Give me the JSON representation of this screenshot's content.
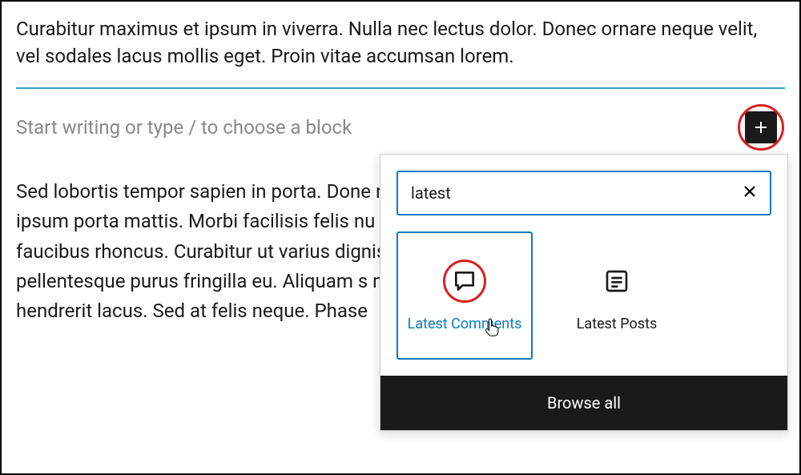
{
  "editor": {
    "paragraph_top": "Curabitur maximus et ipsum in viverra. Nulla nec lectus dolor. Donec ornare neque velit, vel sodales lacus mollis eget. Proin vitae accumsan lorem.",
    "placeholder": "Start writing or type / to choose a block",
    "paragraph_bottom": "Sed lobortis tempor sapien in porta. Done nibh facilisis. In id turpis malesuada, ultric ipsum porta mattis. Morbi facilisis felis nu Vestibulum convallis bibendum dolor, id p erat faucibus rhoncus. Curabitur ut varius dignissim, eu accumsan quam venenatis. pellentesque purus fringilla eu. Aliquam s nunc facilisis placerat ac eu neque. Ut lacu hendrerit lacus. Sed at felis neque. Phase"
  },
  "inserter": {
    "search_value": "latest",
    "blocks": [
      {
        "label": "Latest Comments"
      },
      {
        "label": "Latest Posts"
      }
    ],
    "browse_all": "Browse all"
  }
}
